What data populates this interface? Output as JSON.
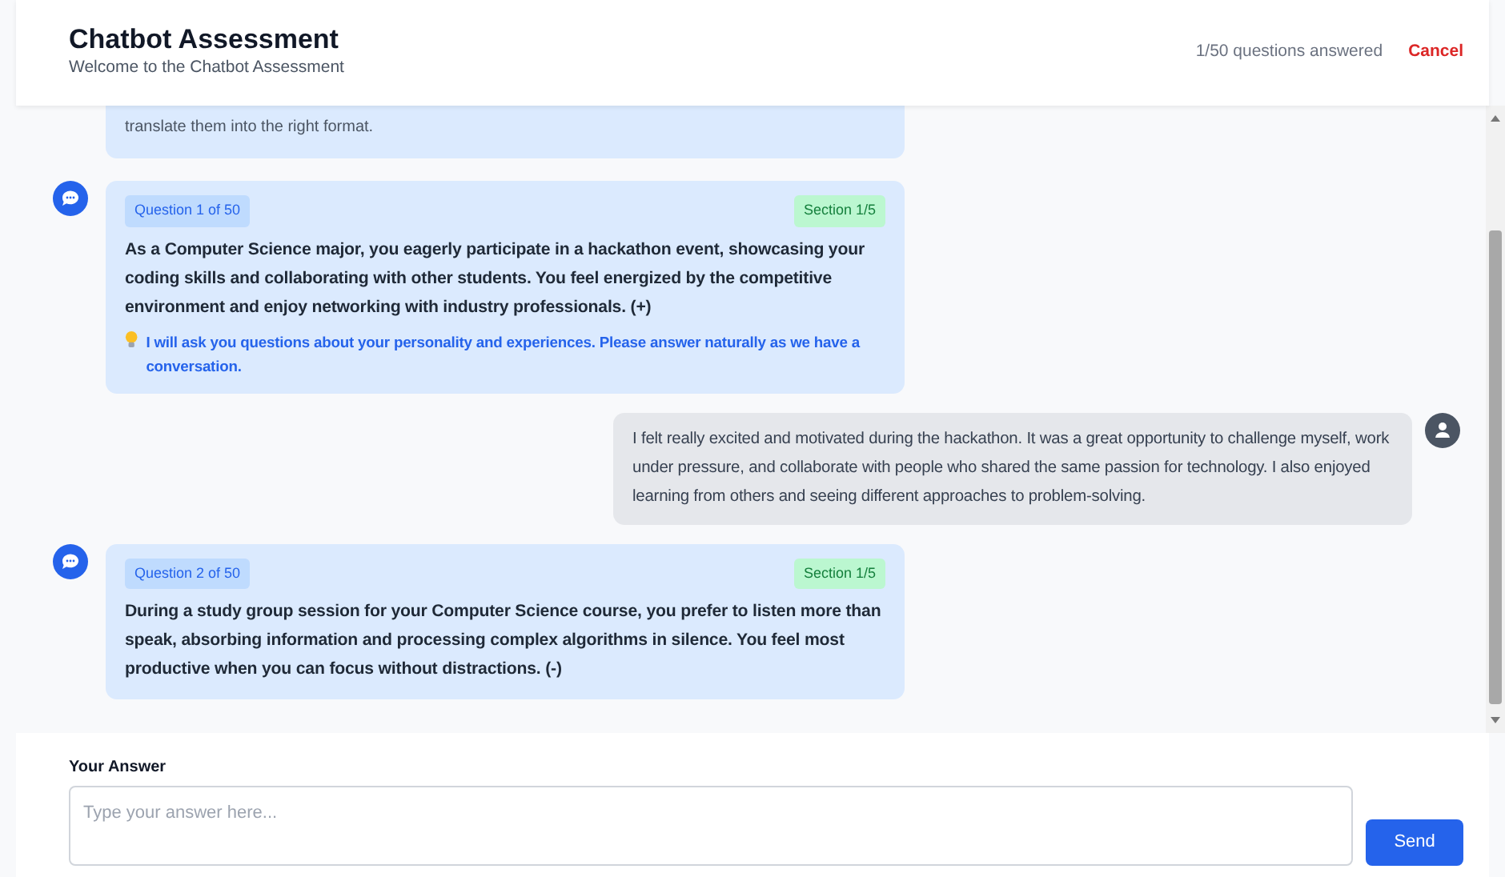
{
  "header": {
    "title": "Chatbot Assessment",
    "subtitle": "Welcome to the Chatbot Assessment",
    "progress": "1/50 questions answered",
    "cancel": "Cancel"
  },
  "messages": [
    {
      "kind": "bot_partial",
      "text": "translate them into the right format."
    },
    {
      "kind": "bot",
      "question": "Question 1 of 50",
      "section": "Section 1/5",
      "text": "As a Computer Science major, you eagerly participate in a hackathon event, showcasing your coding skills and collaborating with other students. You feel energized by the competitive environment and enjoy networking with industry professionals. (+)",
      "hint": "I will ask you questions about your personality and experiences. Please answer naturally as we have a conversation."
    },
    {
      "kind": "user",
      "text": "I felt really excited and motivated during the hackathon. It was a great opportunity to challenge myself, work under pressure, and collaborate with people who shared the same passion for technology. I also enjoyed learning from others and seeing different approaches to problem-solving."
    },
    {
      "kind": "bot",
      "question": "Question 2 of 50",
      "section": "Section 1/5",
      "text": "During a study group session for your Computer Science course, you prefer to listen more than speak, absorbing information and processing complex algorithms in silence. You feel most productive when you can focus without distractions. (-)"
    }
  ],
  "answer": {
    "label": "Your Answer",
    "placeholder": "Type your answer here...",
    "send": "Send"
  }
}
